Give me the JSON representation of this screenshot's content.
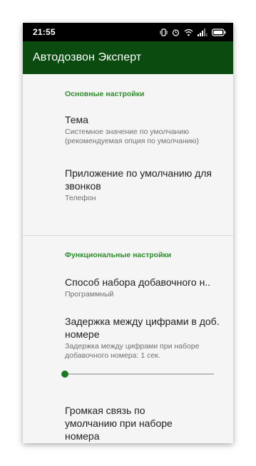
{
  "status_bar": {
    "time": "21:55",
    "icons": [
      "vibrate-icon",
      "alarm-icon",
      "wifi-icon",
      "signal-icon",
      "battery-icon"
    ]
  },
  "app_bar": {
    "title": "Автодозвон Эксперт",
    "color": "#0b4b10"
  },
  "sections": {
    "basic": {
      "header": "Основные настройки",
      "theme": {
        "title": "Тема",
        "summary": "Системное значение по умолчанию (рекомендуемая опция по умолчанию)"
      },
      "default_app": {
        "title": "Приложение по умолчанию для звонков",
        "summary": "Телефон"
      }
    },
    "functional": {
      "header": "Функциональные настройки",
      "dial_method": {
        "title": "Способ набора добавочного н..",
        "summary": "Программный"
      },
      "digit_delay": {
        "title": "Задержка между цифрами в доб. номере",
        "summary": "Задержка между цифрами при наборе добавочного номера:  1 сек.",
        "slider_fraction": 0.0
      },
      "speaker": {
        "title": "Громкая связь по умолчанию при наборе номера",
        "enabled": true
      }
    }
  },
  "colors": {
    "accent": "#2e8b2e",
    "control": "#1f7a1f"
  }
}
